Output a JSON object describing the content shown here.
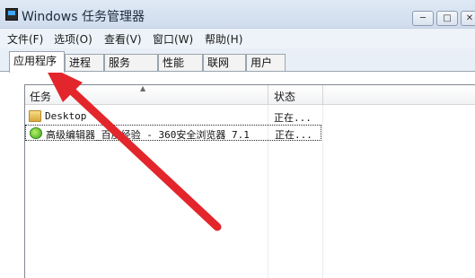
{
  "window": {
    "title": "Windows 任务管理器",
    "buttons": {
      "minimize": "─",
      "maximize": "□",
      "close": "✕"
    }
  },
  "menu": [
    "文件(F)",
    "选项(O)",
    "查看(V)",
    "窗口(W)",
    "帮助(H)"
  ],
  "tabs": [
    "应用程序",
    "进程",
    "服务",
    "性能",
    "联网",
    "用户"
  ],
  "active_tab": "应用程序",
  "list": {
    "columns": {
      "task": "任务",
      "status": "状态"
    },
    "rows": [
      {
        "name": "Desktop",
        "status": "正在...",
        "icon": "folder-icon"
      },
      {
        "name": "高级编辑器_百度经验 - 360安全浏览器 7.1",
        "status": "正在...",
        "icon": "browser-icon",
        "selected": true
      }
    ]
  },
  "annotation": {
    "color": "#e3262b",
    "points_to": "应用程序"
  }
}
